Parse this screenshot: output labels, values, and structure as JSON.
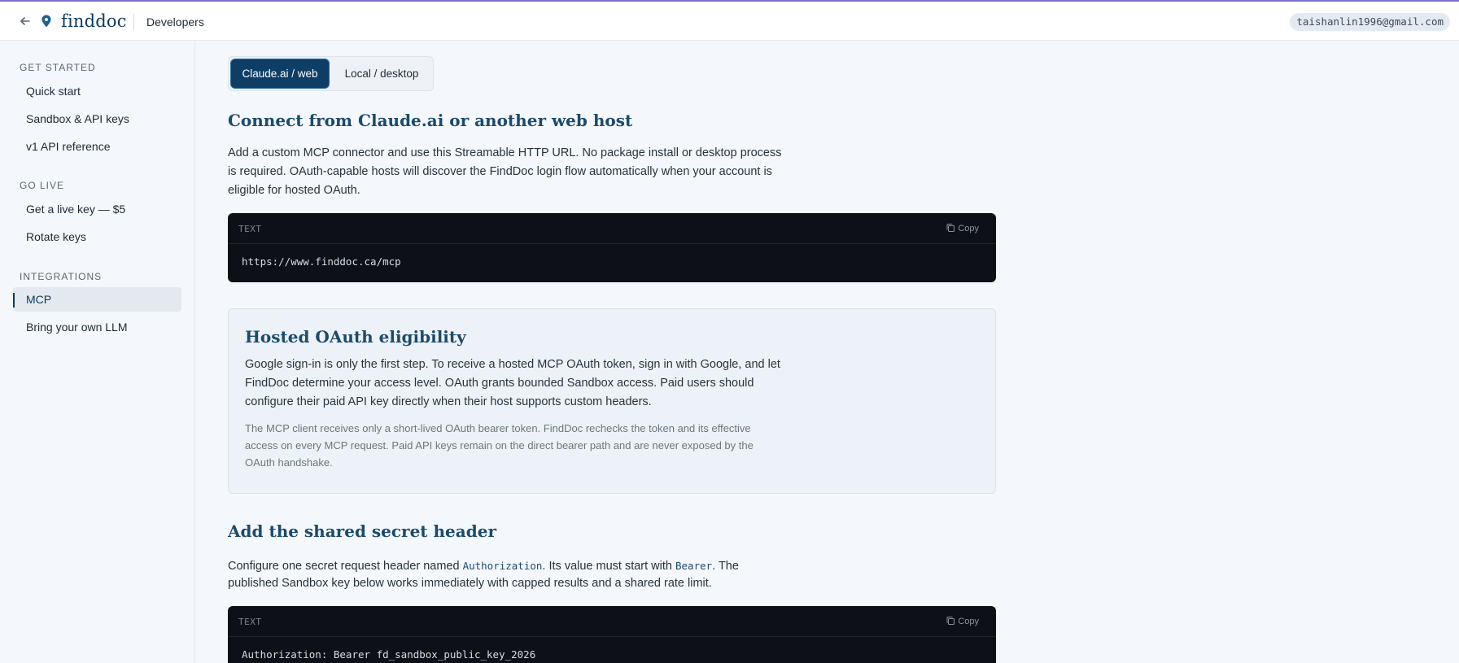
{
  "topbar": {
    "brand": "finddoc",
    "crumb": "Developers",
    "user_email": "taishanlin1996@gmail.com"
  },
  "sidebar": {
    "sections": [
      {
        "title": "GET STARTED",
        "items": [
          "Quick start",
          "Sandbox & API keys",
          "v1 API reference"
        ]
      },
      {
        "title": "GO LIVE",
        "items": [
          "Get a live key — $5",
          "Rotate keys"
        ]
      },
      {
        "title": "INTEGRATIONS",
        "items": [
          "MCP",
          "Bring your own LLM"
        ]
      }
    ],
    "active_item": "MCP"
  },
  "tabs": {
    "active": "Claude.ai / web",
    "inactive": "Local / desktop"
  },
  "section1": {
    "heading": "Connect from Claude.ai or another web host",
    "para_l1": "Add a custom MCP connector and use this Streamable HTTP URL. No package install or desktop process",
    "para_l2": "is required. OAuth-capable hosts will discover the FindDoc login flow automatically when your account is",
    "para_l3": "eligible for hosted OAuth.",
    "code_label": "TEXT",
    "copy_label": "Copy",
    "code": "https://www.finddoc.ca/mcp"
  },
  "callout": {
    "heading": "Hosted OAuth eligibility",
    "para_l1": "Google sign-in is only the first step. To receive a hosted MCP OAuth token, sign in with Google, and let",
    "para_l2": "FindDoc determine your access level. OAuth grants bounded Sandbox access. Paid users should",
    "para_l3": "configure their paid API key directly when their host supports custom headers.",
    "note_l1": "The MCP client receives only a short-lived OAuth bearer token. FindDoc rechecks the token and its effective",
    "note_l2": "access on every MCP request. Paid API keys remain on the direct bearer path and are never exposed by the",
    "note_l3": "OAuth handshake."
  },
  "section2": {
    "heading": "Add the shared secret header",
    "para_a": "Configure one secret request header named ",
    "para_code1": "Authorization",
    "para_b": ". Its value must start with ",
    "para_code2": "Bearer",
    "para_c": ". The",
    "para_l2": "published Sandbox key below works immediately with capped results and a shared rate limit.",
    "code_label": "TEXT",
    "copy_label": "Copy",
    "code": "Authorization: Bearer fd_sandbox_public_key_2026"
  }
}
